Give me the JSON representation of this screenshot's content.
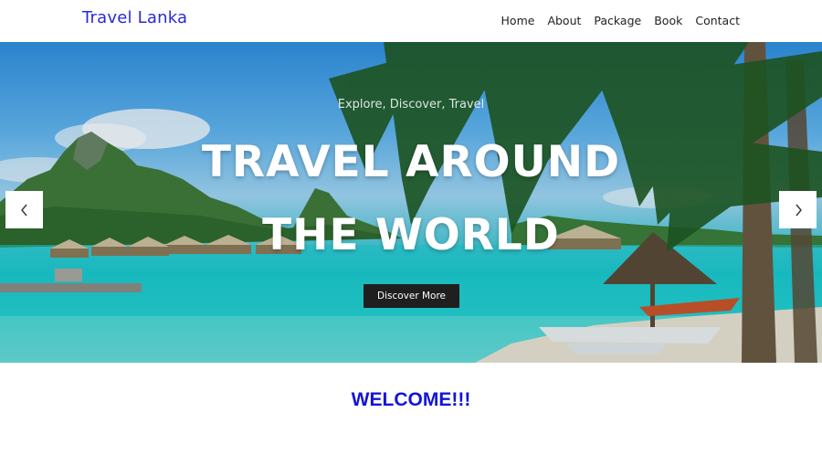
{
  "header": {
    "brand": "Travel Lanka",
    "nav": [
      "Home",
      "About",
      "Package",
      "Book",
      "Contact"
    ]
  },
  "hero": {
    "tagline": "Explore, Discover, Travel",
    "headline_line1": "TRAVEL AROUND",
    "headline_line2": "THE WORLD",
    "cta_label": "Discover More",
    "prev_icon": "chevron-left-icon",
    "next_icon": "chevron-right-icon"
  },
  "welcome": {
    "title": "WELCOME!!!"
  },
  "colors": {
    "brand": "#2a2ad6",
    "welcome": "#1414d9",
    "cta_bg": "#1f1f1f"
  }
}
